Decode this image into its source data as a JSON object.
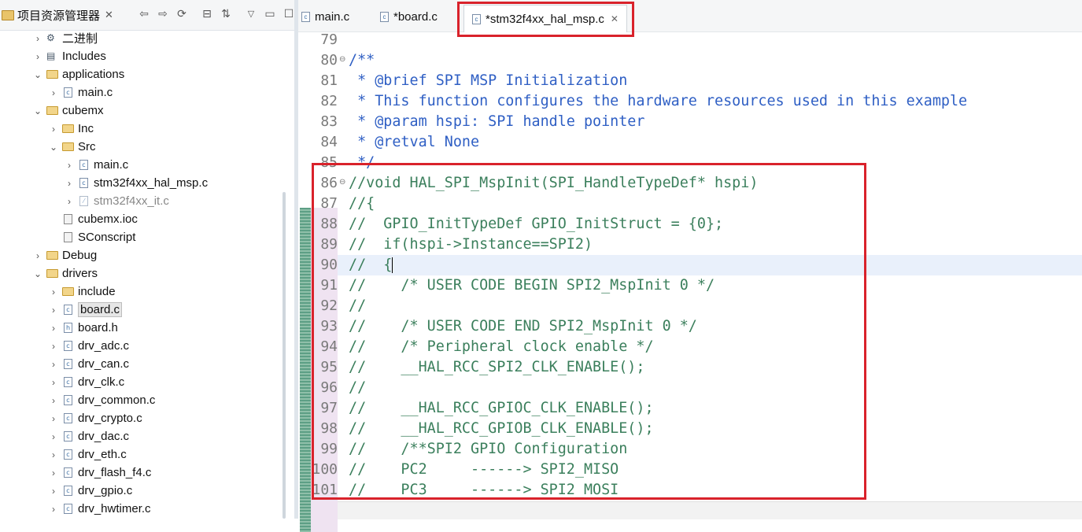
{
  "explorer": {
    "title": "项目资源管理器",
    "items": [
      {
        "label": "二进制",
        "depth": 2,
        "icon": "binary-gear-icon",
        "expanded": false
      },
      {
        "label": "Includes",
        "depth": 2,
        "icon": "library-icon",
        "expanded": false
      },
      {
        "label": "applications",
        "depth": 2,
        "icon": "folder-icon",
        "expanded": true
      },
      {
        "label": "main.c",
        "depth": 3,
        "icon": "c-file-icon",
        "expanded": false
      },
      {
        "label": "cubemx",
        "depth": 2,
        "icon": "folder-icon",
        "expanded": true
      },
      {
        "label": "Inc",
        "depth": 3,
        "icon": "folder-icon",
        "expanded": false
      },
      {
        "label": "Src",
        "depth": 3,
        "icon": "folder-icon",
        "expanded": true
      },
      {
        "label": "main.c",
        "depth": 4,
        "icon": "c-file-icon",
        "expanded": false
      },
      {
        "label": "stm32f4xx_hal_msp.c",
        "depth": 4,
        "icon": "c-file-icon",
        "expanded": false
      },
      {
        "label": "stm32f4xx_it.c",
        "depth": 4,
        "icon": "excluded-file-icon",
        "expanded": false
      },
      {
        "label": "cubemx.ioc",
        "depth": 3,
        "icon": "file-icon",
        "expanded": null
      },
      {
        "label": "SConscript",
        "depth": 3,
        "icon": "file-icon",
        "expanded": null
      },
      {
        "label": "Debug",
        "depth": 2,
        "icon": "folder-icon",
        "expanded": false
      },
      {
        "label": "drivers",
        "depth": 2,
        "icon": "folder-icon",
        "expanded": true
      },
      {
        "label": "include",
        "depth": 3,
        "icon": "folder-icon",
        "expanded": false
      },
      {
        "label": "board.c",
        "depth": 3,
        "icon": "c-file-icon",
        "expanded": false
      },
      {
        "label": "board.h",
        "depth": 3,
        "icon": "h-file-icon",
        "expanded": false
      },
      {
        "label": "drv_adc.c",
        "depth": 3,
        "icon": "c-file-icon",
        "expanded": false
      },
      {
        "label": "drv_can.c",
        "depth": 3,
        "icon": "c-file-icon",
        "expanded": false
      },
      {
        "label": "drv_clk.c",
        "depth": 3,
        "icon": "c-file-icon",
        "expanded": false
      },
      {
        "label": "drv_common.c",
        "depth": 3,
        "icon": "c-file-icon",
        "expanded": false
      },
      {
        "label": "drv_crypto.c",
        "depth": 3,
        "icon": "c-file-icon",
        "expanded": false
      },
      {
        "label": "drv_dac.c",
        "depth": 3,
        "icon": "c-file-icon",
        "expanded": false
      },
      {
        "label": "drv_eth.c",
        "depth": 3,
        "icon": "c-file-icon",
        "expanded": false
      },
      {
        "label": "drv_flash_f4.c",
        "depth": 3,
        "icon": "c-file-icon",
        "expanded": false
      },
      {
        "label": "drv_gpio.c",
        "depth": 3,
        "icon": "c-file-icon",
        "expanded": false
      },
      {
        "label": "drv_hwtimer.c",
        "depth": 3,
        "icon": "c-file-icon",
        "expanded": false
      }
    ],
    "selected_label": "board.c"
  },
  "tabs": [
    {
      "label": "main.c",
      "active": false
    },
    {
      "label": "*board.c",
      "active": false
    },
    {
      "label": "*stm32f4xx_hal_msp.c",
      "active": true
    }
  ],
  "code": [
    {
      "n": "79",
      "text": "",
      "style": "plain"
    },
    {
      "n": "80",
      "text": "/**",
      "style": "doc"
    },
    {
      "n": "81",
      "text": " * @brief SPI MSP Initialization",
      "style": "doc"
    },
    {
      "n": "82",
      "text": " * This function configures the hardware resources used in this example",
      "style": "doc"
    },
    {
      "n": "83",
      "text": " * @param hspi: SPI handle pointer",
      "style": "doc"
    },
    {
      "n": "84",
      "text": " * @retval None",
      "style": "doc"
    },
    {
      "n": "85",
      "text": " */",
      "style": "doc"
    },
    {
      "n": "86",
      "text": "//void HAL_SPI_MspInit(SPI_HandleTypeDef* hspi)",
      "style": "comment"
    },
    {
      "n": "87",
      "text": "//{",
      "style": "comment"
    },
    {
      "n": "88",
      "text": "//  GPIO_InitTypeDef GPIO_InitStruct = {0};",
      "style": "comment"
    },
    {
      "n": "89",
      "text": "//  if(hspi->Instance==SPI2)",
      "style": "comment"
    },
    {
      "n": "90",
      "text": "//  {",
      "style": "comment"
    },
    {
      "n": "91",
      "text": "//    /* USER CODE BEGIN SPI2_MspInit 0 */",
      "style": "comment"
    },
    {
      "n": "92",
      "text": "//",
      "style": "comment"
    },
    {
      "n": "93",
      "text": "//    /* USER CODE END SPI2_MspInit 0 */",
      "style": "comment"
    },
    {
      "n": "94",
      "text": "//    /* Peripheral clock enable */",
      "style": "comment"
    },
    {
      "n": "95",
      "text": "//    __HAL_RCC_SPI2_CLK_ENABLE();",
      "style": "comment"
    },
    {
      "n": "96",
      "text": "//",
      "style": "comment"
    },
    {
      "n": "97",
      "text": "//    __HAL_RCC_GPIOC_CLK_ENABLE();",
      "style": "comment"
    },
    {
      "n": "98",
      "text": "//    __HAL_RCC_GPIOB_CLK_ENABLE();",
      "style": "comment"
    },
    {
      "n": "99",
      "text": "//    /**SPI2 GPIO Configuration",
      "style": "comment"
    },
    {
      "n": "100",
      "text": "//    PC2     ------> SPI2_MISO",
      "style": "comment"
    },
    {
      "n": "101",
      "text": "//    PC3     ------> SPI2_MOSI",
      "style": "comment"
    }
  ],
  "colors": {
    "comment": "#3b7f5c",
    "doc": "#2f5fc4",
    "highlight": "#d9222b"
  }
}
